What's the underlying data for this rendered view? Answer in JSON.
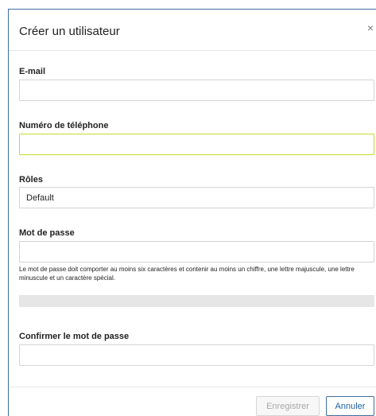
{
  "dialog": {
    "title": "Créer un utilisateur",
    "close_icon": "×"
  },
  "form": {
    "email_label": "E-mail",
    "email_value": "",
    "phone_label": "Numéro de téléphone",
    "phone_value": "",
    "roles_label": "Rôles",
    "roles_value": "Default",
    "password_label": "Mot de passe",
    "password_value": "",
    "password_help": "Le mot de passe doit comporter au moins six caractères et contenir au moins un chiffre, une lettre majuscule, une lettre minuscule et un caractère spécial.",
    "confirm_label": "Confirmer le mot de passe",
    "confirm_value": ""
  },
  "footer": {
    "save_label": "Enregistrer",
    "cancel_label": "Annuler"
  },
  "colors": {
    "accent": "#1f5f9e",
    "focus_border": "#c6dc2e"
  }
}
